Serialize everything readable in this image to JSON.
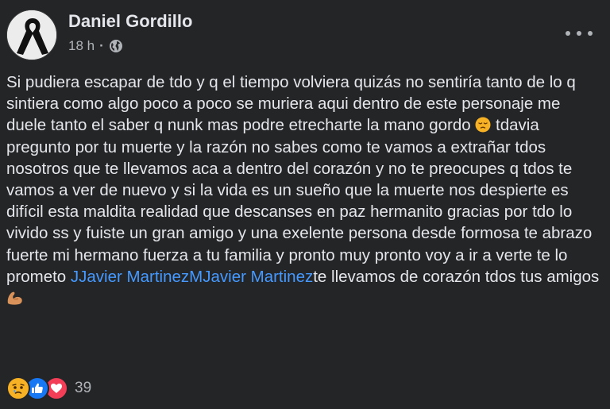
{
  "post": {
    "author": "Daniel Gordillo",
    "time": "18 h",
    "separator": "·",
    "privacy_icon": "globe-icon",
    "more_icon": "more-options-icon",
    "text_part1": "Si pudiera escapar de tdo y q el tiempo volviera quizás no sentiría tanto de lo q sintiera como algo poco a poco se muriera aqui dentro de este personaje me duele tanto el saber q nunk mas podre etrecharte la mano gordo ",
    "emoji1": "pensive-face-emoji",
    "text_part2": " tdavia pregunto por tu muerte y la razón no sabes como te vamos a extrañar tdos nosotros que te llevamos aca a dentro del corazón y no te preocupes q tdos te vamos a ver de nuevo y si la vida es un sueño que la muerte nos despierte es difícil esta maldita realidad que descanses en paz hermanito gracias por tdo lo vivido ss y fuiste un gran amigo y una exelente persona desde formosa te abrazo fuerte mi hermano fuerza a tu familia y pronto muy pronto voy a ir a verte te lo prometo ",
    "tag1": "JJavier Martinez",
    "tag2": "MJavier Martinez",
    "text_part3": "te llevamos de corazón tdos tus amigos",
    "emoji2": "flexed-biceps-emoji"
  },
  "reactions": {
    "icons": [
      "sad-reaction-icon",
      "like-reaction-icon",
      "love-reaction-icon"
    ],
    "count": "39"
  },
  "colors": {
    "background": "#242526",
    "text": "#e4e6eb",
    "secondary": "#b0b3b8",
    "link": "#4599ff",
    "like": "#1877f2",
    "love": "#f33e58",
    "sad": "#f7b125"
  }
}
